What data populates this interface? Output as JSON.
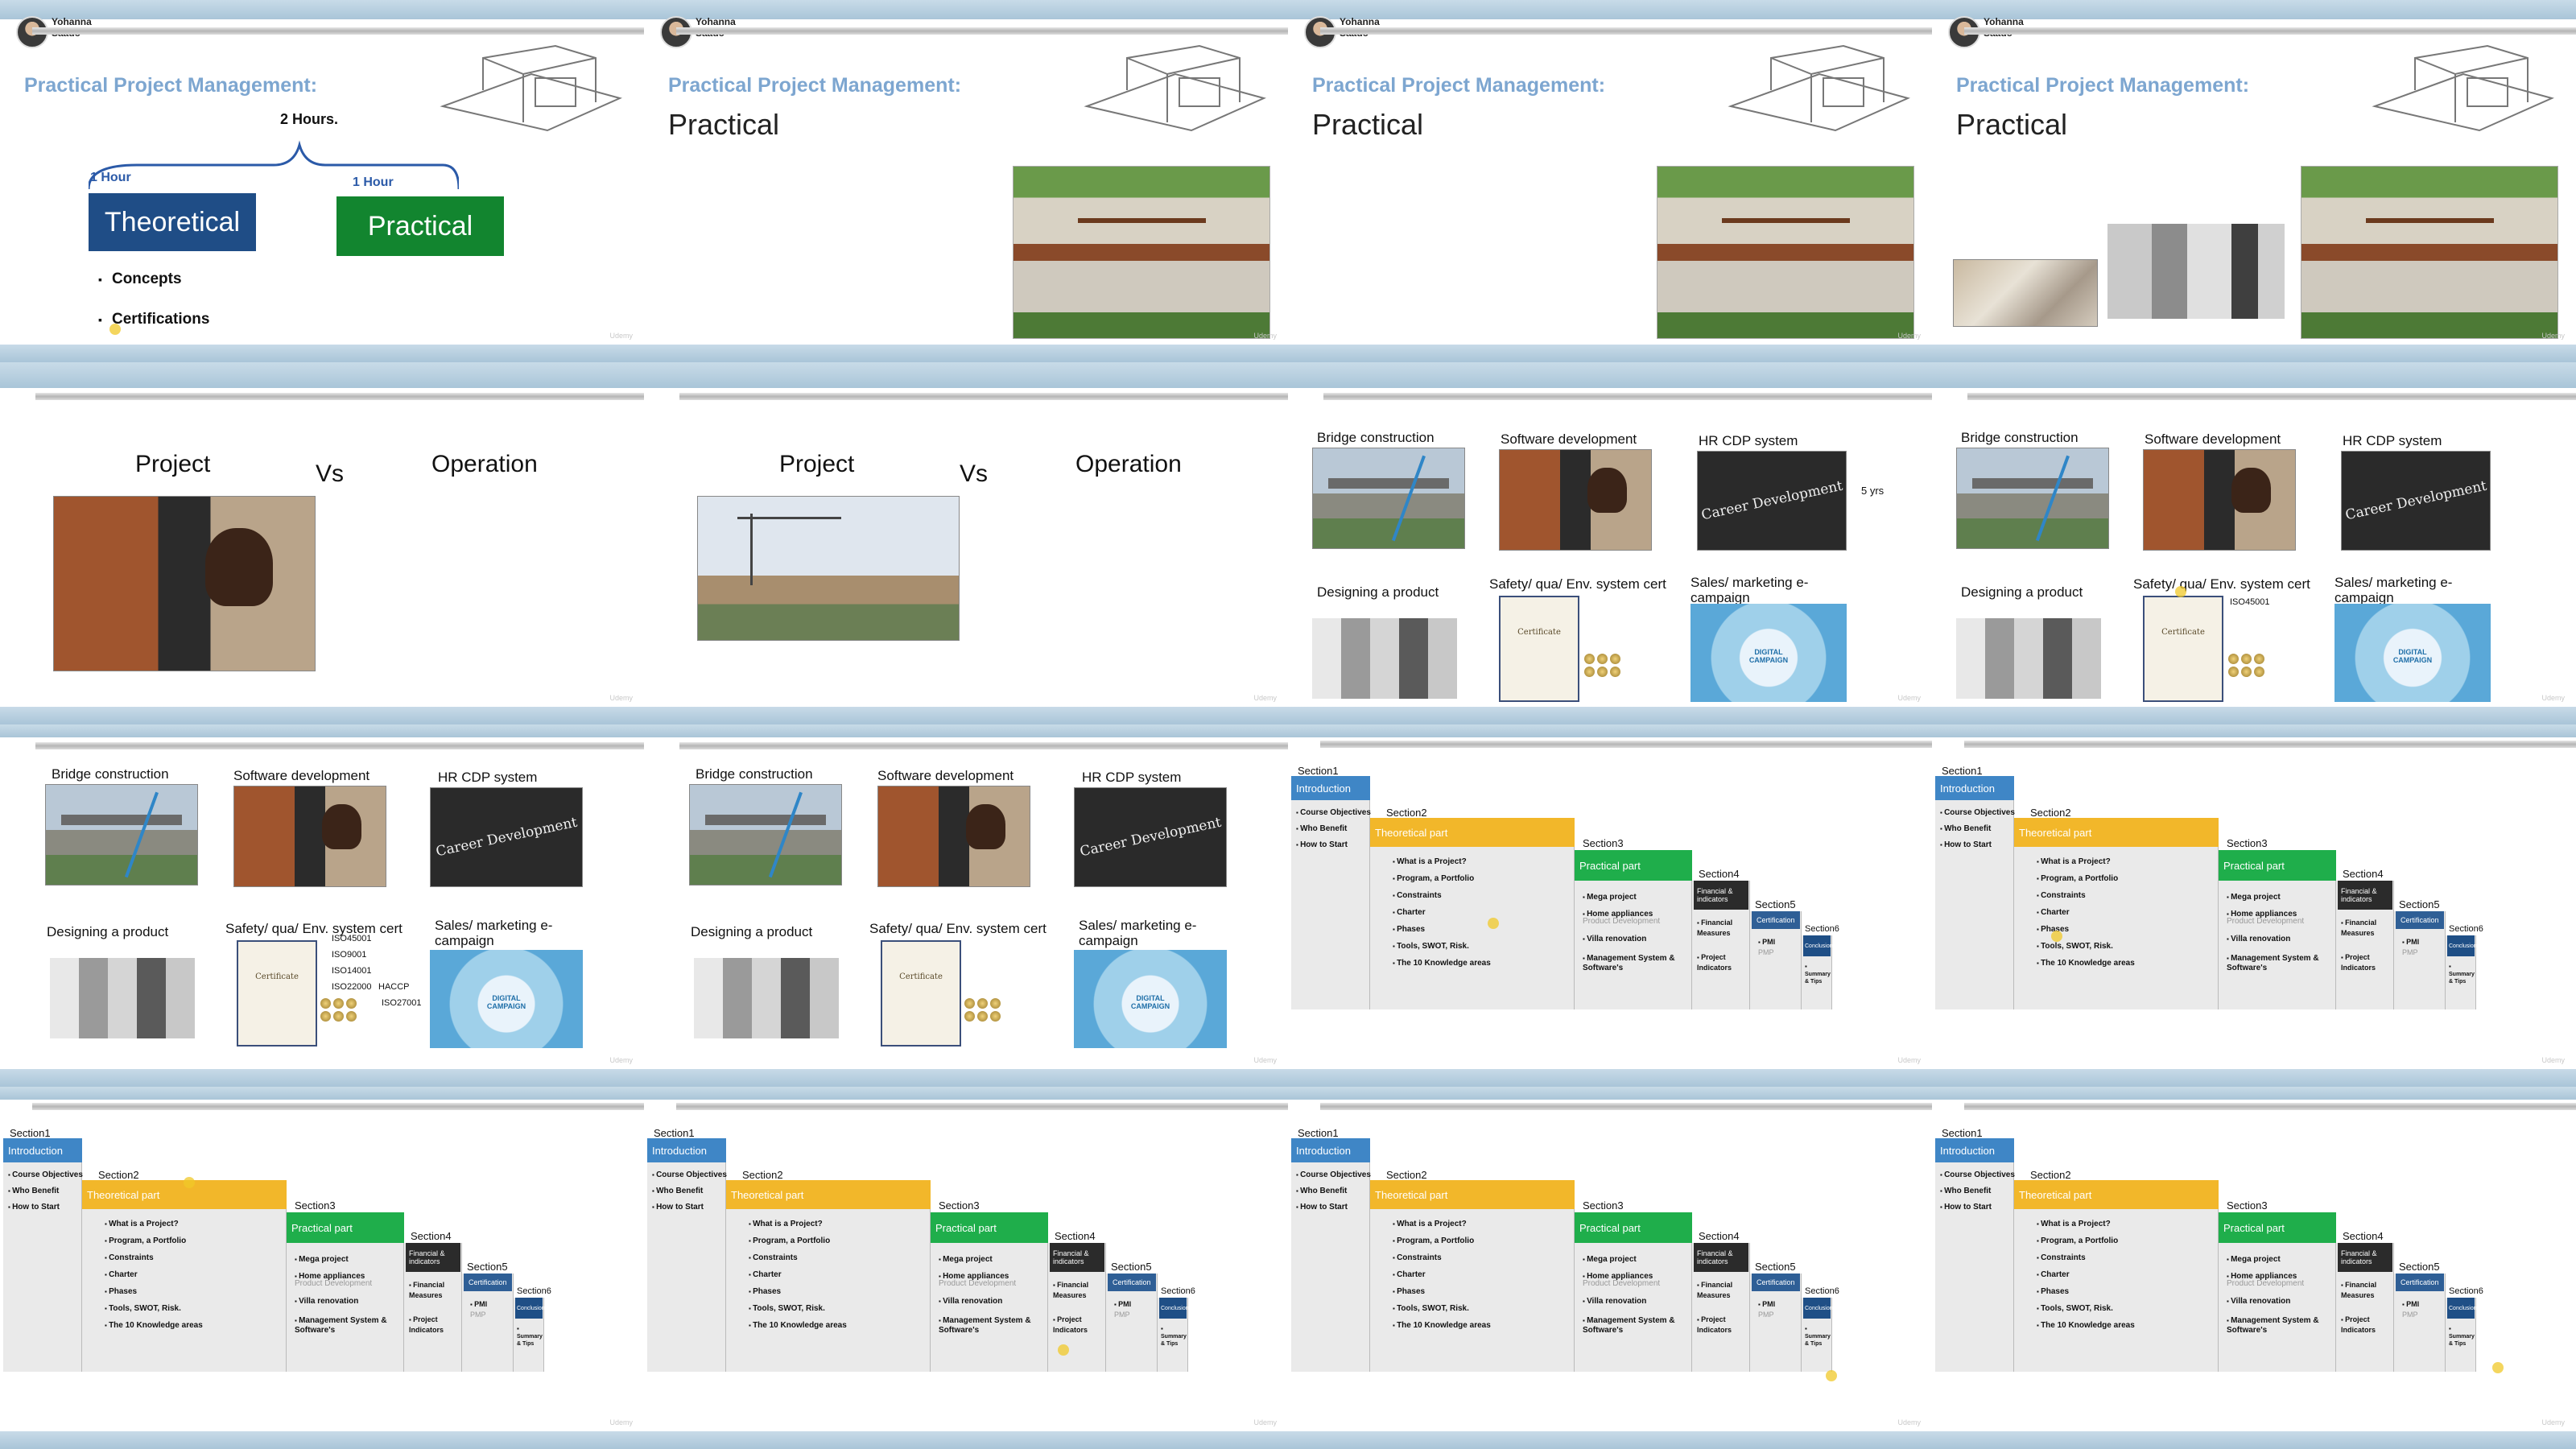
{
  "presenter": {
    "name_line1": "Yohanna",
    "name_line2": "Saado"
  },
  "watermark": "Udemy",
  "slide_titles": {
    "course": "Practical Project Management:",
    "practical": "Practical"
  },
  "slide1": {
    "total": "2 Hours.",
    "hour_left": "1 Hour",
    "hour_right": "1 Hour",
    "theoretical": "Theoretical",
    "practical": "Practical",
    "bullets": [
      "Concepts",
      "Certifications"
    ]
  },
  "project_vs": {
    "project": "Project",
    "vs": "Vs",
    "operation": "Operation"
  },
  "examples": {
    "bridge": "Bridge construction",
    "software": "Software development",
    "hr": "HR CDP system",
    "hr_image": "Career Development",
    "years": "5 yrs",
    "product": "Designing a product",
    "safety": "Safety/ qua/ Env. system cert",
    "sales": "Sales/ marketing e-campaign",
    "iso_single": "ISO45001",
    "iso_list": [
      "ISO45001",
      "ISO9001",
      "ISO14001",
      "ISO22000"
    ],
    "haccp": "HACCP",
    "iso27001": "ISO27001"
  },
  "sections": {
    "s1": {
      "label": "Section1",
      "header": "Introduction",
      "items": [
        "Course Objectives",
        "Who Benefit",
        "How to Start"
      ]
    },
    "s2": {
      "label": "Section2",
      "header": "Theoretical part",
      "items": [
        "What is a Project?",
        "Program, a Portfolio",
        "Constraints",
        "Charter",
        "Phases",
        "Tools, SWOT, Risk.",
        "The 10 Knowledge areas"
      ]
    },
    "s3": {
      "label": "Section3",
      "header": "Practical part",
      "items": [
        "Mega project",
        "Home appliances",
        "Product Development",
        "Villa  renovation",
        "Management System & Software's"
      ]
    },
    "s4": {
      "label": "Section4",
      "header": "Financial & indicators",
      "items": [
        "Financial Measures",
        "Project Indicators"
      ]
    },
    "s5": {
      "label": "Section5",
      "header": "Certification",
      "items": [
        "PMI",
        "PMP"
      ]
    },
    "s6": {
      "label": "Section6",
      "header": "Conclusion",
      "items": [
        "Summary & Tips"
      ]
    }
  },
  "colors": {
    "intro": "#3f86c6",
    "theory": "#f2b72a",
    "practical": "#1fae4b",
    "financial": "#2b2b2b",
    "cert": "#2f5f96",
    "conclusion": "#1f4f86",
    "title_blue": "#7da6d0",
    "theoretical_box": "#1f4d86",
    "practical_box": "#12852f"
  }
}
